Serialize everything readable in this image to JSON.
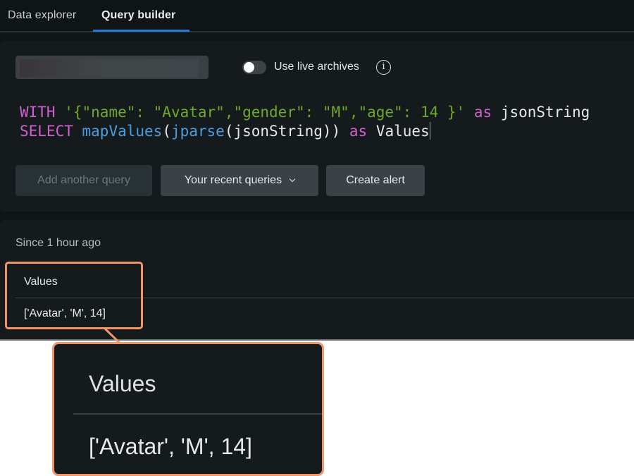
{
  "tabs": [
    {
      "label": "Data explorer",
      "active": false
    },
    {
      "label": "Query builder",
      "active": true
    }
  ],
  "query_panel": {
    "account_selector": {
      "value": "",
      "redacted": true,
      "icon": "chevron-down-icon"
    },
    "live_archives": {
      "label": "Use live archives",
      "enabled": false,
      "info_icon": "info-icon"
    },
    "query": {
      "line1": {
        "keyword_with": "WITH",
        "json_literal": "'{\"name\": \"Avatar\",\"gender\": \"M\",\"age\": 14 }'",
        "keyword_as": "as",
        "alias": "jsonString"
      },
      "line2": {
        "keyword_select": "SELECT",
        "fn_outer": "mapValues",
        "paren_open_1": "(",
        "fn_inner": "jparse",
        "paren_open_2": "(",
        "arg": "jsonString",
        "paren_close": "))",
        "keyword_as": "as",
        "alias": "Values"
      }
    },
    "buttons": {
      "add_query": "Add another query",
      "recent_queries": "Your recent queries",
      "create_alert": "Create alert"
    }
  },
  "results": {
    "time_range": "Since 1 hour ago",
    "columns": [
      "Values"
    ],
    "rows": [
      [
        "['Avatar', 'M', 14]"
      ]
    ]
  },
  "colors": {
    "accent_tab": "#2b74d9",
    "highlight": "#f0956a",
    "keyword": "#d060d0",
    "string": "#6fa82a",
    "function": "#4a9ee0"
  }
}
